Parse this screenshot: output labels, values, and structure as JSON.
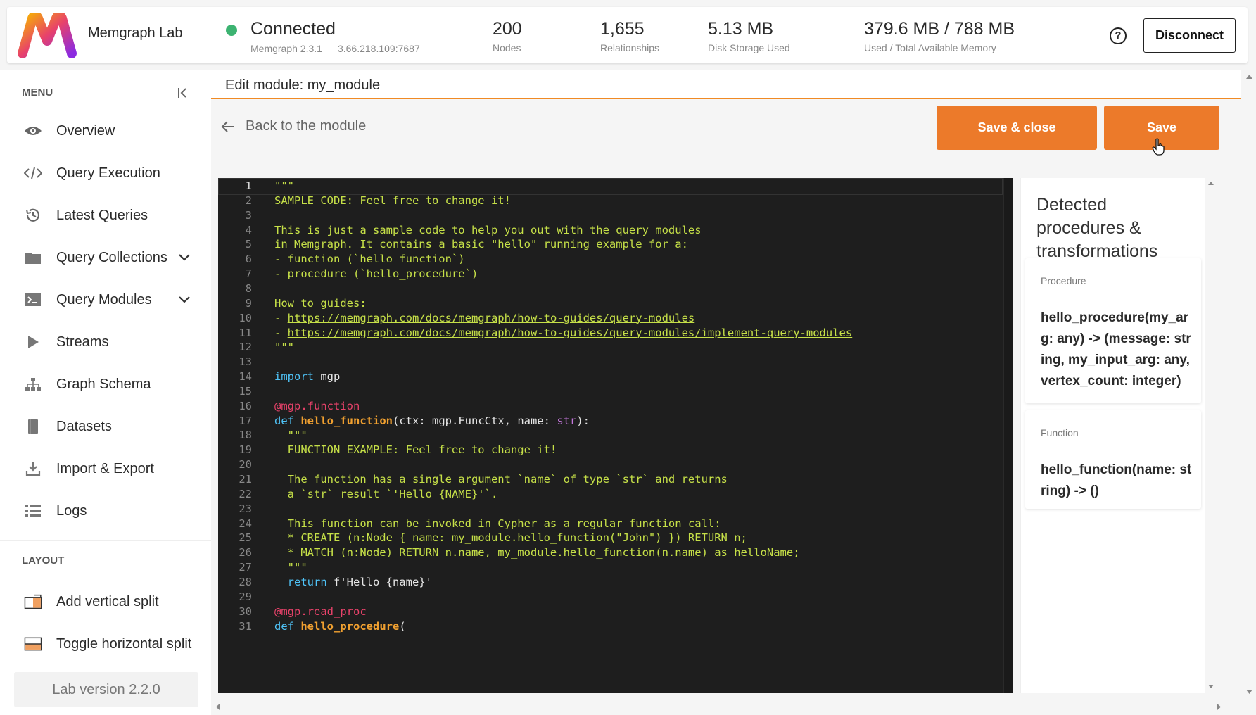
{
  "app": {
    "brand": "Memgraph Lab"
  },
  "connection": {
    "status": "Connected",
    "version": "Memgraph 2.3.1",
    "address": "3.66.218.109:7687",
    "status_color": "#3cb371"
  },
  "stats": {
    "nodes": {
      "value": "200",
      "label": "Nodes"
    },
    "relationships": {
      "value": "1,655",
      "label": "Relationships"
    },
    "disk": {
      "value": "5.13 MB",
      "label": "Disk Storage Used"
    },
    "memory": {
      "value": "379.6 MB / 788 MB",
      "label": "Used / Total Available Memory"
    }
  },
  "header": {
    "help_icon": "help-circle-icon",
    "disconnect_label": "Disconnect"
  },
  "sidebar": {
    "menu_title": "MENU",
    "items": [
      {
        "label": "Overview",
        "icon": "eye-icon"
      },
      {
        "label": "Query Execution",
        "icon": "code-icon"
      },
      {
        "label": "Latest Queries",
        "icon": "history-icon"
      },
      {
        "label": "Query Collections",
        "icon": "folder-icon",
        "expandable": true
      },
      {
        "label": "Query Modules",
        "icon": "terminal-icon",
        "expandable": true
      },
      {
        "label": "Streams",
        "icon": "play-icon"
      },
      {
        "label": "Graph Schema",
        "icon": "hierarchy-icon"
      },
      {
        "label": "Datasets",
        "icon": "book-icon"
      },
      {
        "label": "Import & Export",
        "icon": "download-icon"
      },
      {
        "label": "Logs",
        "icon": "list-icon"
      }
    ],
    "layout_title": "LAYOUT",
    "layout_items": [
      {
        "label": "Add vertical split",
        "icon": "vertical-split-icon"
      },
      {
        "label": "Toggle horizontal split",
        "icon": "horizontal-split-icon"
      }
    ],
    "version": "Lab version 2.2.0"
  },
  "main": {
    "title": "Edit module: my_module",
    "back_label": "Back to the module",
    "save_close_label": "Save & close",
    "save_label": "Save",
    "accent": "#ec7a2a"
  },
  "editor": {
    "active_line": 1,
    "lines": [
      "\"\"\"",
      "SAMPLE CODE: Feel free to change it!",
      "",
      "This is just a sample code to help you out with the query modules",
      "in Memgraph. It contains a basic \"hello\" running example for a:",
      "- function (`hello_function`)",
      "- procedure (`hello_procedure`)",
      "",
      "How to guides:",
      "- https://memgraph.com/docs/memgraph/how-to-guides/query-modules",
      "- https://memgraph.com/docs/memgraph/how-to-guides/query-modules/implement-query-modules",
      "\"\"\"",
      "",
      "import mgp",
      "",
      "@mgp.function",
      "def hello_function(ctx: mgp.FuncCtx, name: str):",
      "  \"\"\"",
      "  FUNCTION EXAMPLE: Feel free to change it!",
      "",
      "  The function has a single argument `name` of type `str` and returns",
      "  a `str` result `'Hello {NAME}'`.",
      "",
      "  This function can be invoked in Cypher as a regular function call:",
      "  * CREATE (n:Node { name: my_module.hello_function(\"John\") }) RETURN n;",
      "  * MATCH (n:Node) RETURN n.name, my_module.hello_function(n.name) as helloName;",
      "  \"\"\"",
      "  return f'Hello {name}'",
      "",
      "@mgp.read_proc",
      "def hello_procedure("
    ]
  },
  "detected": {
    "title": "Detected procedures & transformations",
    "items": [
      {
        "kind": "Procedure",
        "signature": "hello_procedure(my_arg: any) -> (message: string, my_input_arg: any, vertex_count: integer)"
      },
      {
        "kind": "Function",
        "signature": "hello_function(name: string) -> ()"
      }
    ]
  }
}
